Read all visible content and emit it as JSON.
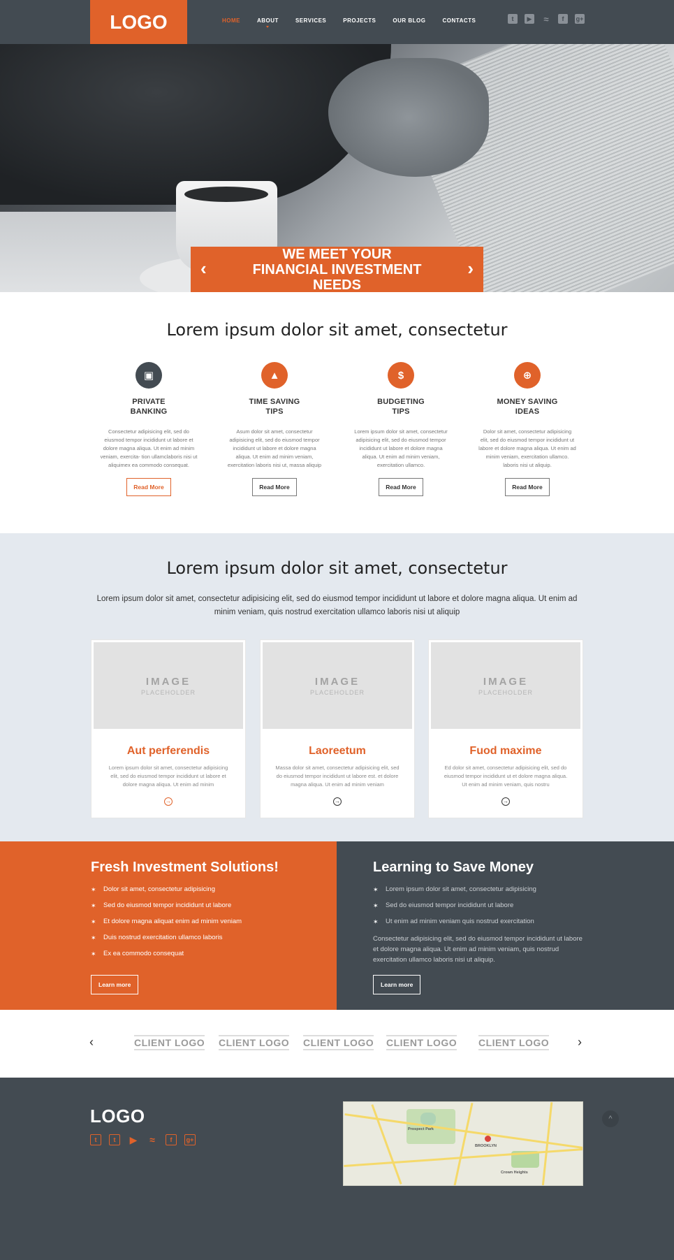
{
  "header": {
    "logo": "LOGO",
    "nav": [
      "HOME",
      "ABOUT",
      "SERVICES",
      "PROJECTS",
      "OUR BLOG",
      "CONTACTS"
    ],
    "social_icons": [
      "twitter-icon",
      "youtube-icon",
      "rss-icon",
      "facebook-icon",
      "google-plus-icon"
    ]
  },
  "hero": {
    "title": "WE MEET YOUR FINANCIAL INVESTMENT NEEDS",
    "prev": "‹",
    "next": "›"
  },
  "features": {
    "title": "Lorem ipsum dolor sit amet, consectetur",
    "items": [
      {
        "line1": "PRIVATE",
        "line2": "BANKING",
        "icon": "wallet-icon",
        "text": "Consectetur adipisicing elit, sed do eiusmod tempor incididunt ut labore et dolore magna aliqua. Ut enim ad minim veniam, exercita- tion ullamclaboris nisi ut aliquimex ea commodo consequat.",
        "button": "Read More"
      },
      {
        "line1": "TIME SAVING",
        "line2": "TIPS",
        "icon": "chart-icon",
        "text": "Asum dolor sit amet, consectetur adipisicing elit, sed do eiusmod tempor incididunt ut labore et dolore magna aliqua. Ut enim ad minim veniam, exercitation laboris nisi ut, massa aliquip",
        "button": "Read More"
      },
      {
        "line1": "BUDGETING",
        "line2": "TIPS",
        "icon": "money-bag-icon",
        "text": "Lorem ipsum dolor sit amet, consectetur adipisicing elit, sed do eiusmod tempor incididunt ut labore et dolore magna aliqua. Ut enim ad minim veniam, exercitation ullamco.",
        "button": "Read More"
      },
      {
        "line1": "MONEY SAVING",
        "line2": "IDEAS",
        "icon": "globe-dollar-icon",
        "text": "Dolor sit amet, consectetur adipisicing elit, sed do eiusmod tempor incididunt ut labore et dolore magna aliqua. Ut enim ad minim veniam, exercitation ullamco. laboris nisi ut aliquip.",
        "button": "Read More"
      }
    ]
  },
  "projects": {
    "title": "Lorem ipsum dolor sit amet, consectetur",
    "lead": "Lorem ipsum dolor sit amet, consectetur adipisicing elit, sed do eiusmod tempor incididunt ut labore et dolore magna aliqua. Ut enim ad minim veniam, quis nostrud exercitation ullamco laboris nisi ut aliquip",
    "placeholder_top": "IMAGE",
    "placeholder_bottom": "PLACEHOLDER",
    "cards": [
      {
        "title": "Aut perferendis",
        "text": "Lorem ipsum dolor sit amet, consectetur adipisicing elit, sed do eiusmod tempor incididunt ut labore et dolore magna aliqua. Ut enim ad minim"
      },
      {
        "title": "Laoreetum",
        "text": "Massa dolor sit amet, consectetur adipisicing elit, sed do eiusmod tempor incididunt ut labore est. et dolore magna aliqua. Ut enim ad minim veniam"
      },
      {
        "title": "Fuod maxime",
        "text": "Ed dolor sit amet, consectetur adipisicing elit, sed do eiusmod tempor incididunt ut et dolore magna aliqua. Ut enim ad minim veniam, quis nostru"
      }
    ]
  },
  "split": {
    "left": {
      "title": "Fresh Investment Solutions!",
      "items": [
        "Dolor sit amet, consectetur adipisicing",
        "Sed do eiusmod tempor incididunt ut labore",
        "Et dolore magna aliquat enim ad minim veniam",
        "Duis nostrud exercitation ullamco laboris",
        "Ex ea commodo consequat"
      ],
      "button": "Learn more"
    },
    "right": {
      "title": "Learning to Save Money",
      "items": [
        "Lorem ipsum dolor sit amet, consectetur adipisicing",
        "Sed do eiusmod tempor incididunt ut labore",
        "Ut enim ad minim veniam quis nostrud exercitation"
      ],
      "paragraph": "Consectetur adipisicing elit, sed do eiusmod tempor incididunt ut labore et dolore magna aliqua. Ut enim ad minim veniam, quis nostrud exercitation ullamco laboris nisi ut aliquip.",
      "button": "Learn more"
    }
  },
  "clients": {
    "prev": "‹",
    "next": "›",
    "logos": [
      "CLIENT LOGO",
      "CLIENT LOGO",
      "CLIENT LOGO",
      "CLIENT LOGO",
      "CLIENT LOGO"
    ]
  },
  "footer": {
    "logo": "LOGO",
    "social_icons": [
      "tumblr-icon",
      "twitter-icon",
      "youtube-icon",
      "rss-icon",
      "facebook-icon",
      "google-plus-icon"
    ],
    "map_labels": [
      "BROOKLYN",
      "Prospect Park",
      "Crown Heights"
    ],
    "to_top": "^"
  }
}
